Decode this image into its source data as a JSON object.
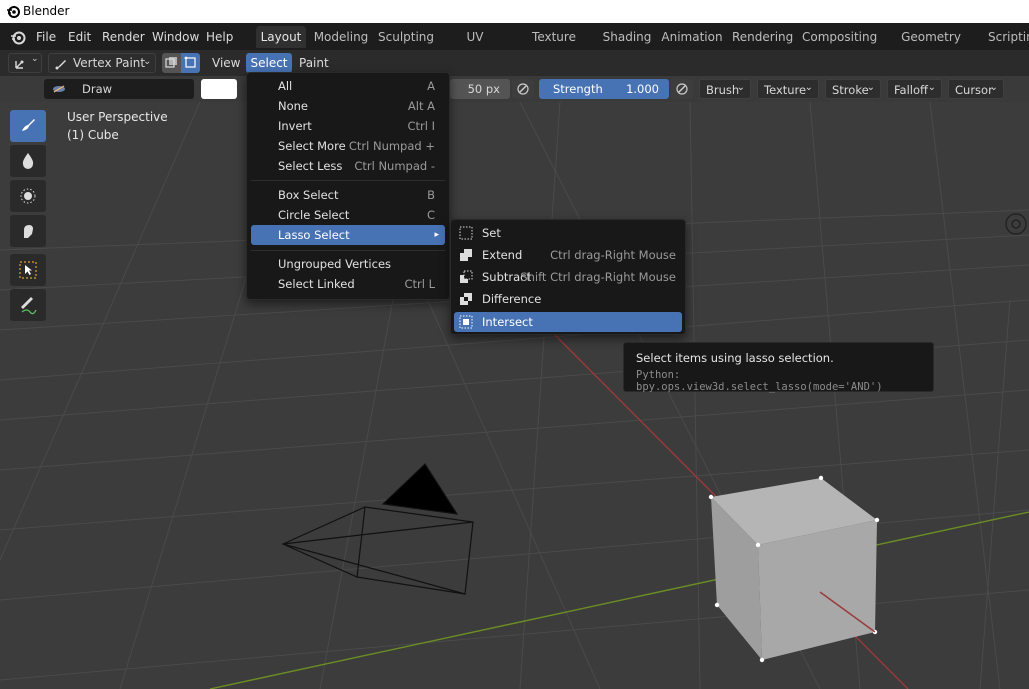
{
  "window": {
    "title": "Blender"
  },
  "menubar": {
    "items": [
      "File",
      "Edit",
      "Render",
      "Window",
      "Help"
    ],
    "workspaces": [
      "Layout",
      "Modeling",
      "Sculpting",
      "UV Editing",
      "Texture Paint",
      "Shading",
      "Animation",
      "Rendering",
      "Compositing",
      "Geometry Nodes",
      "Scripting"
    ],
    "active_workspace": "Layout"
  },
  "header": {
    "mode": "Vertex Paint",
    "menus": [
      "View",
      "Select",
      "Paint"
    ]
  },
  "toolsettings": {
    "brush_name": "Draw",
    "radius": "50 px",
    "strength_label": "Strength",
    "strength_value": "1.000",
    "dropdowns": [
      "Brush",
      "Texture",
      "Stroke",
      "Falloff",
      "Cursor"
    ]
  },
  "viewport": {
    "perspective": "User Perspective",
    "object": "(1) Cube"
  },
  "select_menu": {
    "items": [
      {
        "label": "All",
        "shortcut": "A"
      },
      {
        "label": "None",
        "shortcut": "Alt A"
      },
      {
        "label": "Invert",
        "shortcut": "Ctrl I"
      },
      {
        "label": "Select More",
        "shortcut": "Ctrl Numpad +"
      },
      {
        "label": "Select Less",
        "shortcut": "Ctrl Numpad -"
      },
      {
        "label": "Box Select",
        "shortcut": "B"
      },
      {
        "label": "Circle Select",
        "shortcut": "C"
      },
      {
        "label": "Lasso Select",
        "shortcut": "▸"
      },
      {
        "label": "Ungrouped Vertices",
        "shortcut": ""
      },
      {
        "label": "Select Linked",
        "shortcut": "Ctrl L"
      }
    ],
    "highlighted": "Lasso Select"
  },
  "lasso_submenu": {
    "items": [
      {
        "label": "Set",
        "shortcut": ""
      },
      {
        "label": "Extend",
        "shortcut": "Ctrl drag-Right Mouse"
      },
      {
        "label": "Subtract",
        "shortcut": "Shift Ctrl drag-Right Mouse"
      },
      {
        "label": "Difference",
        "shortcut": ""
      },
      {
        "label": "Intersect",
        "shortcut": ""
      }
    ],
    "highlighted": "Intersect"
  },
  "tooltip": {
    "description": "Select items using lasso selection.",
    "python": "Python: bpy.ops.view3d.select_lasso(mode='AND')"
  },
  "colors": {
    "accent": "#4772b3",
    "menu_bg": "#181818",
    "viewport_bg": "#3c3c3c"
  }
}
